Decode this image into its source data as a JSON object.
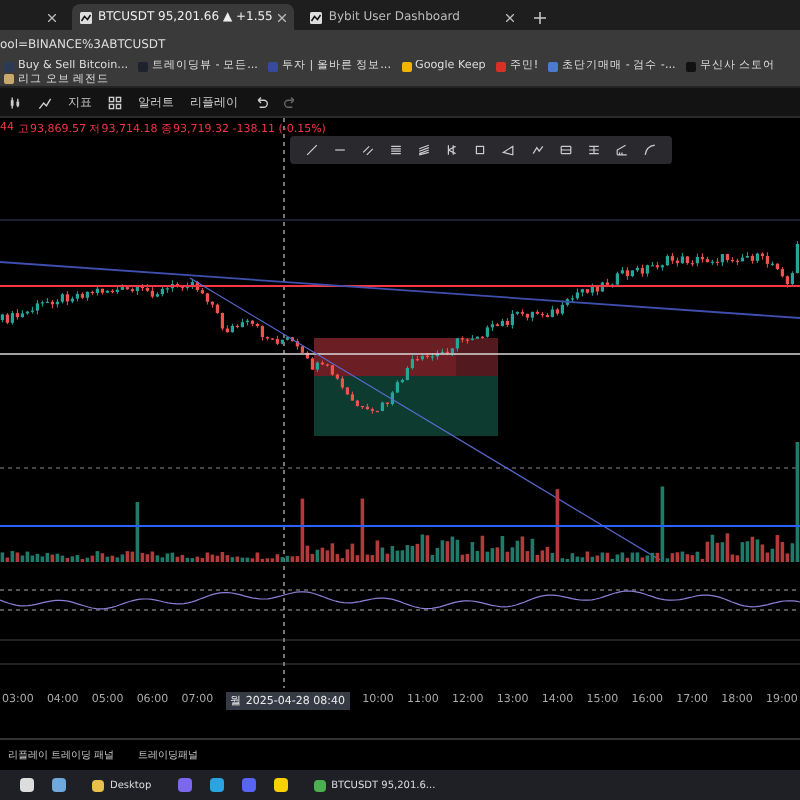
{
  "tabs": [
    {
      "selected": false
    },
    {
      "title": "BTCUSDT 95,201.66 ▲ +1.55",
      "selected": true
    },
    {
      "title": "Bybit User Dashboard",
      "selected": false
    }
  ],
  "address_bar": {
    "url": "ool=BINANCE%3ABTCUSDT"
  },
  "bookmarks": [
    {
      "label": "Buy & Sell Bitcoin...",
      "color": "#2b3a55"
    },
    {
      "label": "트레이딩뷰 - 모든...",
      "color": "#1e222d"
    },
    {
      "label": "투자 | 올바른 정보...",
      "color": "#3a4a9a"
    },
    {
      "label": "Google Keep",
      "color": "#f5b400"
    },
    {
      "label": "주민!",
      "color": "#d93025"
    },
    {
      "label": "초단기매매 - 검수 -...",
      "color": "#4a7bd0"
    },
    {
      "label": "무신사 스토어",
      "color": "#111111"
    },
    {
      "label": "리그 오브 레전드",
      "color": "#c8aa6e"
    }
  ],
  "chart_toolbar": {
    "buttons": [
      {
        "label": "지표"
      },
      {
        "label": "알러트"
      },
      {
        "label": "리플레이"
      }
    ]
  },
  "legend": {
    "prefix": "44",
    "ohlc": "고93,869.57 저93,714.18 종93,719.32 -138.11 (-0.15%)"
  },
  "time_axis": [
    {
      "kind": "tick",
      "label": "03:00"
    },
    {
      "kind": "tick",
      "label": "04:00"
    },
    {
      "kind": "tick",
      "label": "05:00"
    },
    {
      "kind": "tick",
      "label": "06:00"
    },
    {
      "kind": "tick",
      "label": "07:00"
    },
    {
      "kind": "cursor",
      "label": "월 2025-04-28  08:40"
    },
    {
      "kind": "tick",
      "label": "10:00"
    },
    {
      "kind": "tick",
      "label": "11:00"
    },
    {
      "kind": "tick",
      "label": "12:00"
    },
    {
      "kind": "tick",
      "label": "13:00"
    },
    {
      "kind": "tick",
      "label": "14:00"
    },
    {
      "kind": "tick",
      "label": "15:00"
    },
    {
      "kind": "tick",
      "label": "16:00"
    },
    {
      "kind": "tick",
      "label": "17:00"
    },
    {
      "kind": "tick",
      "label": "18:00"
    },
    {
      "kind": "tick",
      "label": "19:00"
    }
  ],
  "bottom_panel": {
    "tabs": [
      {
        "label": "리플레이 트레이딩 패널"
      },
      {
        "label": "트레이딩패널"
      }
    ]
  },
  "taskbar": [
    {
      "kind": "app",
      "color": "#dddddd"
    },
    {
      "kind": "app",
      "color": "#6fa8dc"
    },
    {
      "kind": "window",
      "label": "Desktop",
      "color": "#e8c14a"
    },
    {
      "kind": "app",
      "color": "#7b68ee"
    },
    {
      "kind": "app",
      "color": "#2aa3e0"
    },
    {
      "kind": "app",
      "color": "#5865f2"
    },
    {
      "kind": "app",
      "color": "#f7d100"
    },
    {
      "kind": "window",
      "label": "BTCUSDT 95,201.6...",
      "color": "#4caf50"
    }
  ]
}
